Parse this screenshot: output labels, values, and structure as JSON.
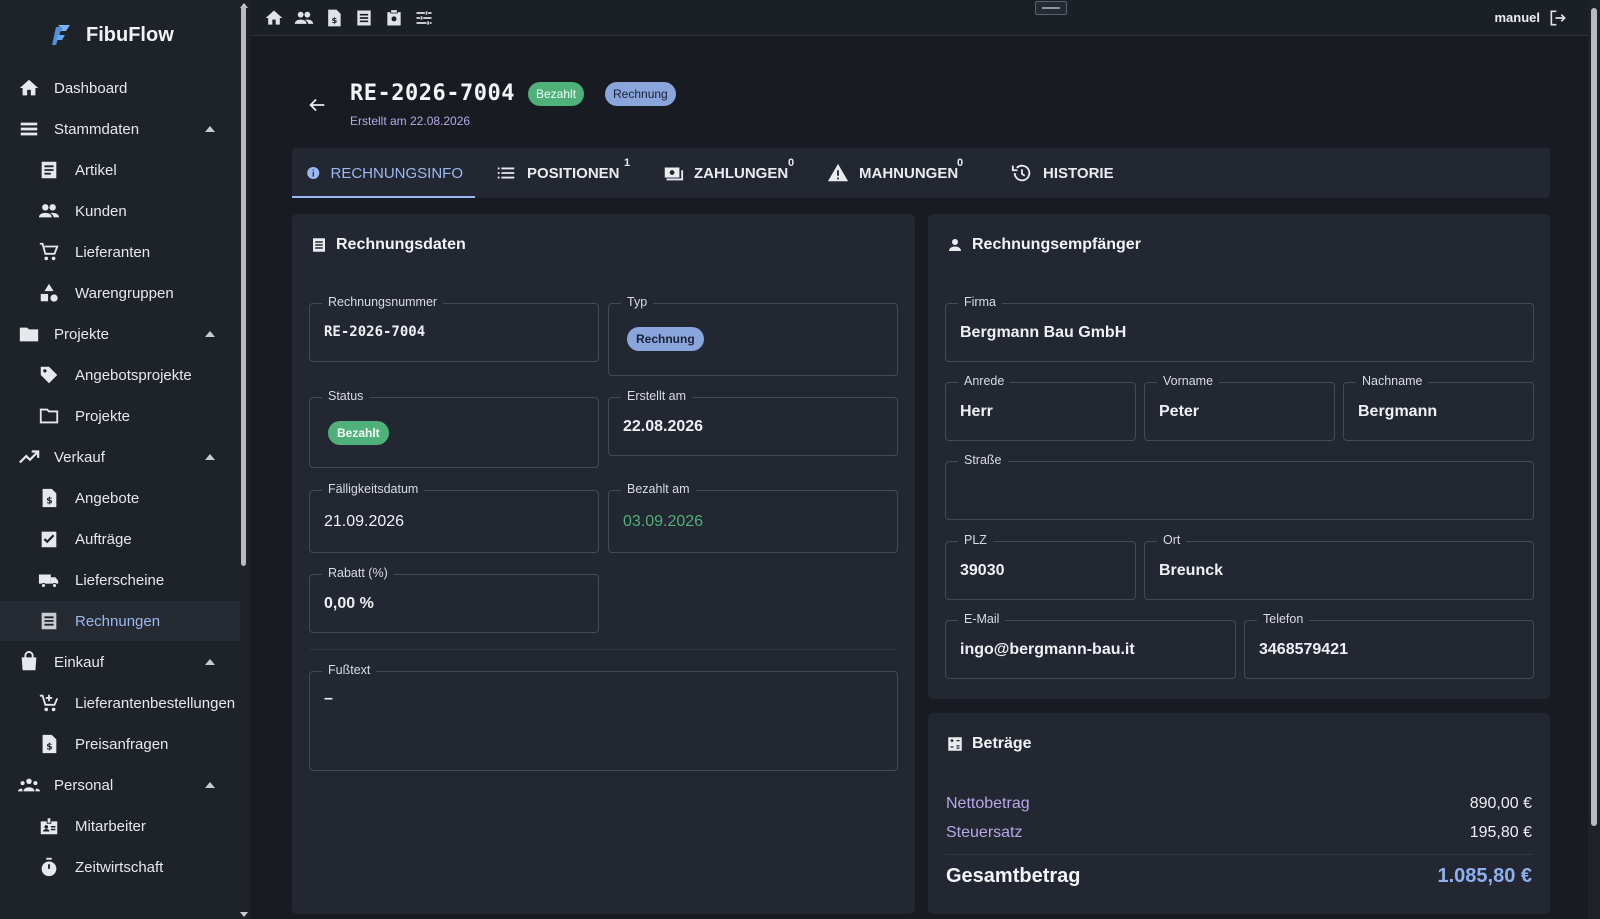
{
  "app": {
    "name": "FibuFlow"
  },
  "user": {
    "name": "manuel"
  },
  "sidebar": {
    "items": [
      {
        "label": "Dashboard"
      },
      {
        "label": "Stammdaten"
      },
      {
        "label": "Artikel"
      },
      {
        "label": "Kunden"
      },
      {
        "label": "Lieferanten"
      },
      {
        "label": "Warengruppen"
      },
      {
        "label": "Projekte"
      },
      {
        "label": "Angebotsprojekte"
      },
      {
        "label": "Projekte"
      },
      {
        "label": "Verkauf"
      },
      {
        "label": "Angebote"
      },
      {
        "label": "Aufträge"
      },
      {
        "label": "Lieferscheine"
      },
      {
        "label": "Rechnungen"
      },
      {
        "label": "Einkauf"
      },
      {
        "label": "Lieferantenbestellungen"
      },
      {
        "label": "Preisanfragen"
      },
      {
        "label": "Personal"
      },
      {
        "label": "Mitarbeiter"
      },
      {
        "label": "Zeitwirtschaft"
      }
    ],
    "active": "Rechnungen"
  },
  "invoice": {
    "number": "RE-2026-7004",
    "status_badge": "Bezahlt",
    "type_badge": "Rechnung",
    "created_line": "Erstellt am 22.08.2026"
  },
  "tabs": [
    {
      "label": "RECHNUNGSINFO",
      "count": ""
    },
    {
      "label": "POSITIONEN",
      "count": "1"
    },
    {
      "label": "ZAHLUNGEN",
      "count": "0"
    },
    {
      "label": "MAHNUNGEN",
      "count": "0"
    },
    {
      "label": "HISTORIE",
      "count": ""
    }
  ],
  "invoice_data": {
    "title": "Rechnungsdaten",
    "fields": {
      "number": {
        "label": "Rechnungsnummer",
        "value": "RE-2026-7004"
      },
      "type": {
        "label": "Typ",
        "value": "Rechnung"
      },
      "status": {
        "label": "Status",
        "value": "Bezahlt"
      },
      "created": {
        "label": "Erstellt am",
        "value": "22.08.2026"
      },
      "due": {
        "label": "Fälligkeitsdatum",
        "value": "21.09.2026"
      },
      "paid": {
        "label": "Bezahlt am",
        "value": "03.09.2026"
      },
      "discount": {
        "label": "Rabatt (%)",
        "value": "0,00 %"
      },
      "footer": {
        "label": "Fußtext",
        "value": "–"
      }
    }
  },
  "recipient": {
    "title": "Rechnungsempfänger",
    "fields": {
      "company": {
        "label": "Firma",
        "value": "Bergmann Bau GmbH"
      },
      "salutation": {
        "label": "Anrede",
        "value": "Herr"
      },
      "first_name": {
        "label": "Vorname",
        "value": "Peter"
      },
      "last_name": {
        "label": "Nachname",
        "value": "Bergmann"
      },
      "street": {
        "label": "Straße",
        "value": ""
      },
      "zip": {
        "label": "PLZ",
        "value": "39030"
      },
      "city": {
        "label": "Ort",
        "value": "Breunck"
      },
      "email": {
        "label": "E-Mail",
        "value": "ingo@bergmann-bau.it"
      },
      "phone": {
        "label": "Telefon",
        "value": "3468579421"
      }
    }
  },
  "amounts": {
    "title": "Beträge",
    "net": {
      "label": "Nettobetrag",
      "value": "890,00 €"
    },
    "tax": {
      "label": "Steuersatz",
      "value": "195,80 €"
    },
    "total": {
      "label": "Gesamtbetrag",
      "value": "1.085,80 €"
    }
  },
  "colors": {
    "accent": "#9cb8f2",
    "paid_green": "#4fb07a",
    "type_blue": "#8aa4dc",
    "label_purple": "#b9a7e6"
  }
}
